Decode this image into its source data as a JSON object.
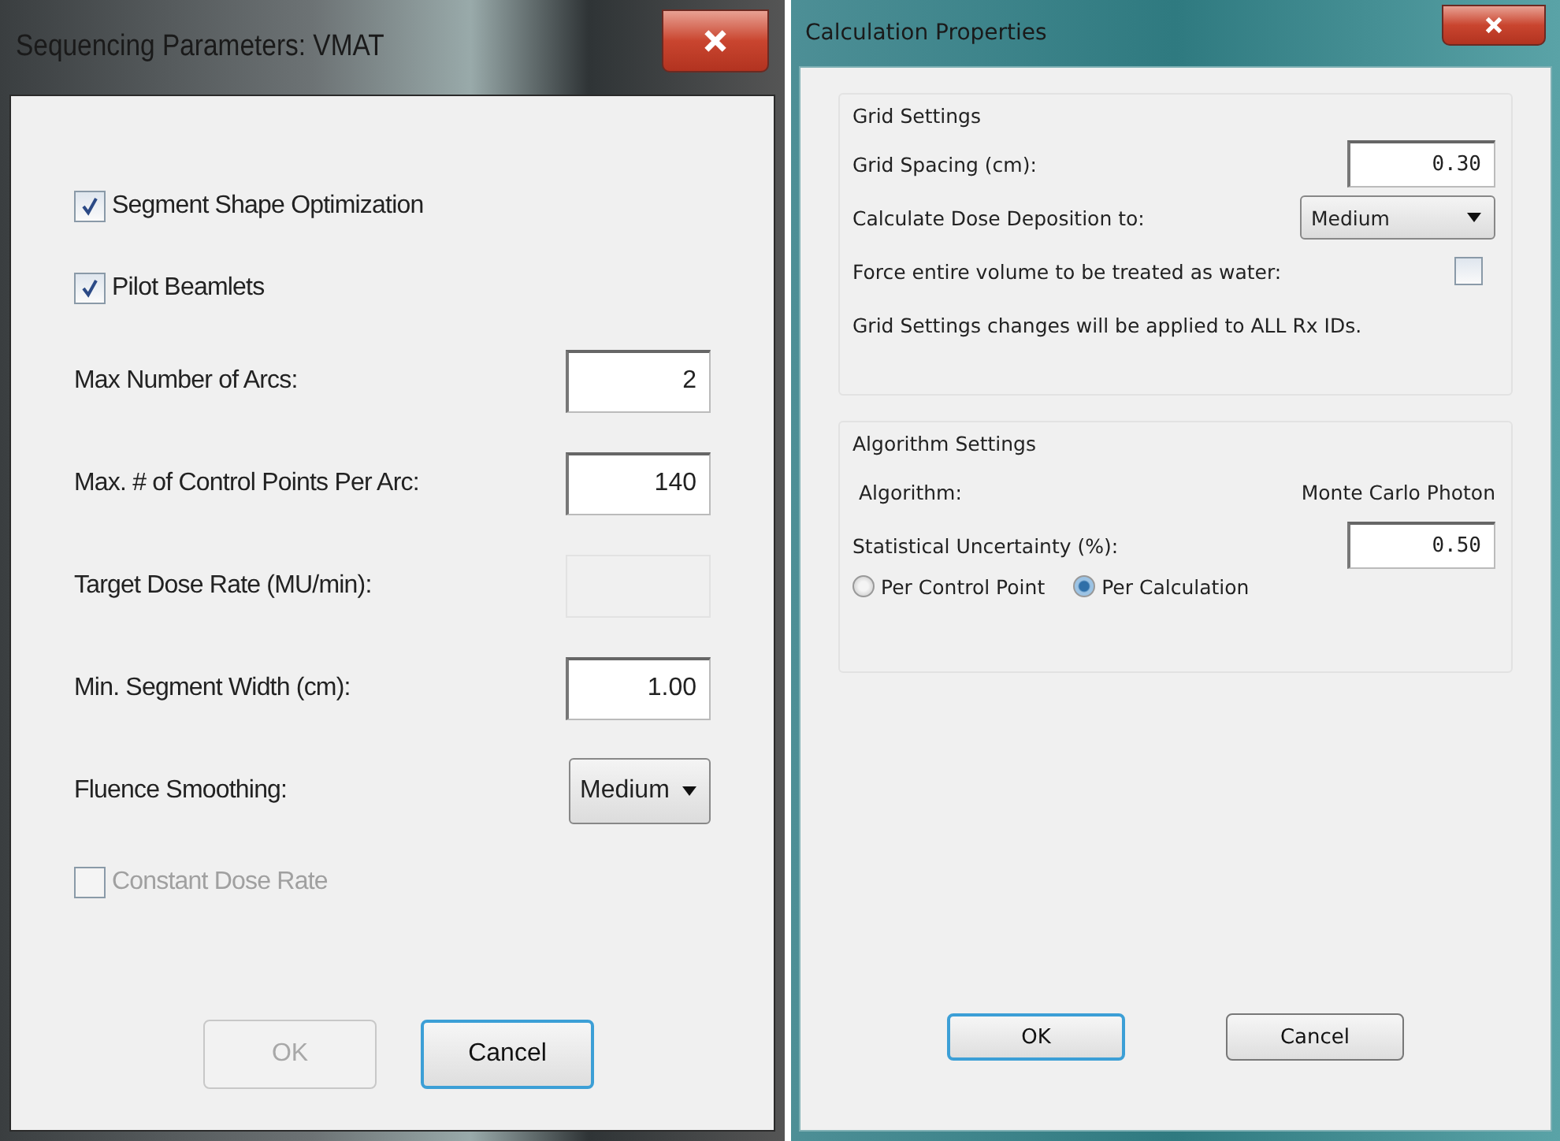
{
  "sequencing": {
    "title": "Sequencing Parameters: VMAT",
    "items": [
      {
        "kind": "checkbox",
        "label": "Segment Shape Optimization",
        "checked": true,
        "disabled": false
      },
      {
        "kind": "checkbox",
        "label": "Pilot Beamlets",
        "checked": true,
        "disabled": false
      },
      {
        "kind": "number",
        "label": "Max Number of Arcs:",
        "value": "2",
        "disabled": false
      },
      {
        "kind": "number",
        "label": "Max. # of Control Points Per Arc:",
        "value": "140",
        "disabled": false
      },
      {
        "kind": "number",
        "label": "Target Dose Rate (MU/min):",
        "disabled": true
      },
      {
        "kind": "number",
        "label": "Min. Segment Width (cm):",
        "value": "1.00",
        "disabled": false
      },
      {
        "kind": "select",
        "label": "Fluence Smoothing:",
        "value": "Medium"
      },
      {
        "kind": "checkbox",
        "label": "Constant Dose Rate",
        "checked": false,
        "disabled": true
      }
    ],
    "buttons": [
      {
        "label": "OK",
        "disabled": true,
        "focused": false
      },
      {
        "label": "Cancel",
        "disabled": false,
        "focused": true
      }
    ]
  },
  "calculation": {
    "title": "Calculation Properties",
    "groups": [
      {
        "title": "Grid Settings",
        "items": [
          {
            "kind": "number",
            "label": "Grid Spacing (cm):",
            "value": "0.30",
            "disabled": false
          },
          {
            "kind": "select",
            "label": "Calculate Dose Deposition to:",
            "value": "Medium"
          },
          {
            "kind": "check_field",
            "label": "Force entire volume to be treated as water:",
            "checked": false,
            "disabled": false
          },
          {
            "kind": "note",
            "label": "Grid Settings changes will be applied to ALL Rx IDs."
          }
        ]
      },
      {
        "title": "Algorithm Settings",
        "items": [
          {
            "kind": "info",
            "label": "Algorithm:",
            "value": "Monte Carlo Photon"
          },
          {
            "kind": "number",
            "label": "Statistical Uncertainty (%):",
            "value": "0.50",
            "disabled": false
          },
          {
            "kind": "radios",
            "options": [
              {
                "label": "Per Control Point",
                "selected": false
              },
              {
                "label": "Per Calculation",
                "selected": true
              }
            ]
          }
        ]
      }
    ],
    "buttons": [
      {
        "label": "OK",
        "disabled": false,
        "focused": true
      },
      {
        "label": "Cancel",
        "disabled": false,
        "focused": false
      }
    ]
  }
}
